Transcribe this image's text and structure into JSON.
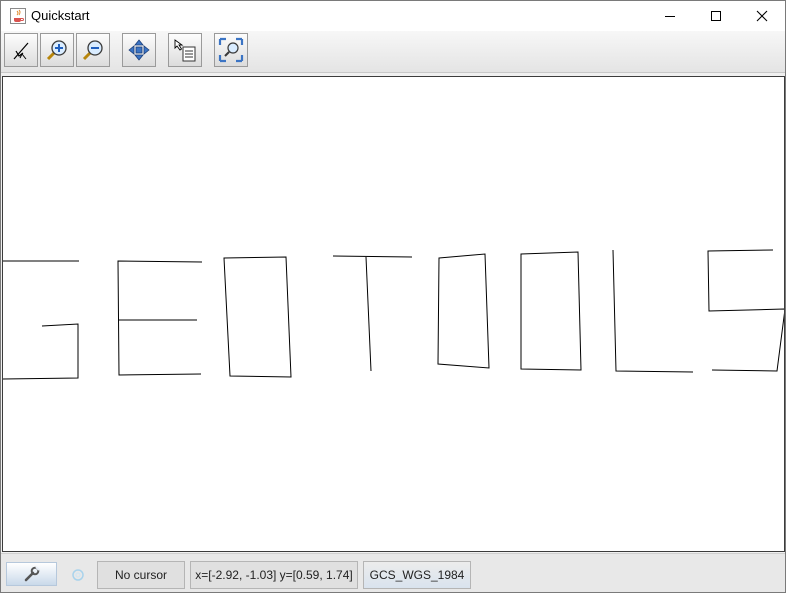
{
  "window": {
    "title": "Quickstart"
  },
  "toolbar": {
    "tools": [
      {
        "name": "select-tool",
        "icon": "pointer-icon"
      },
      {
        "name": "zoom-in-tool",
        "icon": "zoom-in-icon"
      },
      {
        "name": "zoom-out-tool",
        "icon": "zoom-out-icon"
      },
      {
        "name": "pan-tool",
        "icon": "pan-arrows-icon"
      },
      {
        "name": "info-tool",
        "icon": "info-pointer-icon"
      },
      {
        "name": "reset-tool",
        "icon": "zoom-extent-icon"
      }
    ]
  },
  "map": {
    "layer_color": "#000000"
  },
  "statusbar": {
    "cursor_text": "No cursor",
    "extent_text": "x=[-2.92, -1.03] y=[0.59, 1.74]",
    "crs_text": "GCS_WGS_1984"
  }
}
